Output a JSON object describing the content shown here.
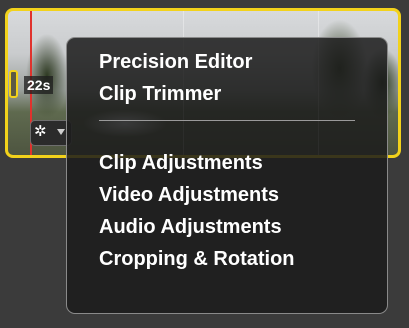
{
  "clip": {
    "duration_label": "22s",
    "gear_symbol": "✲"
  },
  "menu": {
    "group1": [
      {
        "label": "Precision Editor"
      },
      {
        "label": "Clip Trimmer"
      }
    ],
    "group2": [
      {
        "label": "Clip Adjustments"
      },
      {
        "label": "Video Adjustments"
      },
      {
        "label": "Audio Adjustments"
      },
      {
        "label": "Cropping & Rotation"
      }
    ]
  },
  "colors": {
    "selection_border": "#f2d21b",
    "playhead": "#e0322d",
    "menu_background": "#1c1c1c"
  }
}
